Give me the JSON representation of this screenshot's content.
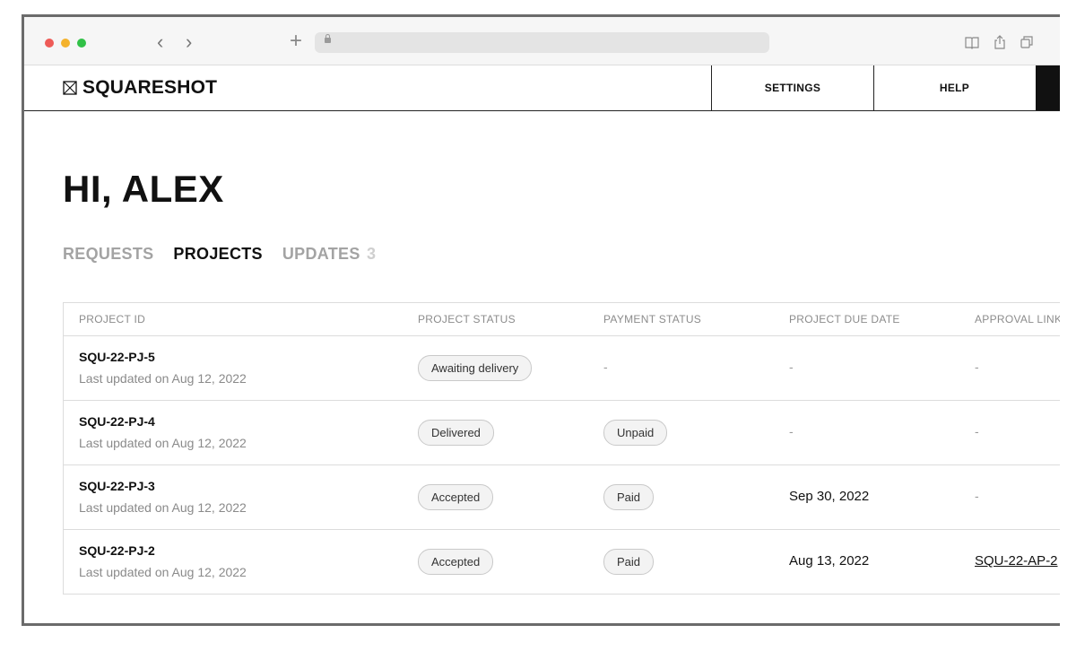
{
  "browser": {
    "icons": [
      "back-arrow-icon",
      "forward-arrow-icon",
      "new-tab-plus-icon",
      "lock-icon",
      "reader-icon",
      "share-icon",
      "tabs-icon"
    ],
    "back_glyph": "‹",
    "forward_glyph": "›",
    "plus_glyph": "+"
  },
  "header": {
    "logo_text": "SQUARESHOT",
    "settings_label": "SETTINGS",
    "help_label": "HELP"
  },
  "greeting": "HI, ALEX",
  "tabs": {
    "requests": "REQUESTS",
    "projects": "PROJECTS",
    "updates": "UPDATES",
    "updates_count": "3"
  },
  "table": {
    "columns": [
      "PROJECT ID",
      "PROJECT STATUS",
      "PAYMENT STATUS",
      "PROJECT DUE DATE",
      "APPROVAL LINK"
    ],
    "rows": [
      {
        "id": "SQU-22-PJ-5",
        "updated": "Last updated on Aug 12, 2022",
        "project_status": "Awaiting delivery",
        "payment_status": "-",
        "due_date": "-",
        "approval": "-"
      },
      {
        "id": "SQU-22-PJ-4",
        "updated": "Last updated on Aug 12, 2022",
        "project_status": "Delivered",
        "payment_status": "Unpaid",
        "due_date": "-",
        "approval": "-"
      },
      {
        "id": "SQU-22-PJ-3",
        "updated": "Last updated on Aug 12, 2022",
        "project_status": "Accepted",
        "payment_status": "Paid",
        "due_date": "Sep 30, 2022",
        "approval": "-"
      },
      {
        "id": "SQU-22-PJ-2",
        "updated": "Last updated on Aug 12, 2022",
        "project_status": "Accepted",
        "payment_status": "Paid",
        "due_date": "Aug 13, 2022",
        "approval": "SQU-22-AP-2"
      }
    ]
  },
  "colors": {
    "chrome_red": "#ee5b57",
    "chrome_yellow": "#f4b22c",
    "chrome_green": "#31c147",
    "text_primary": "#111111",
    "text_muted": "#8a8a8a"
  }
}
